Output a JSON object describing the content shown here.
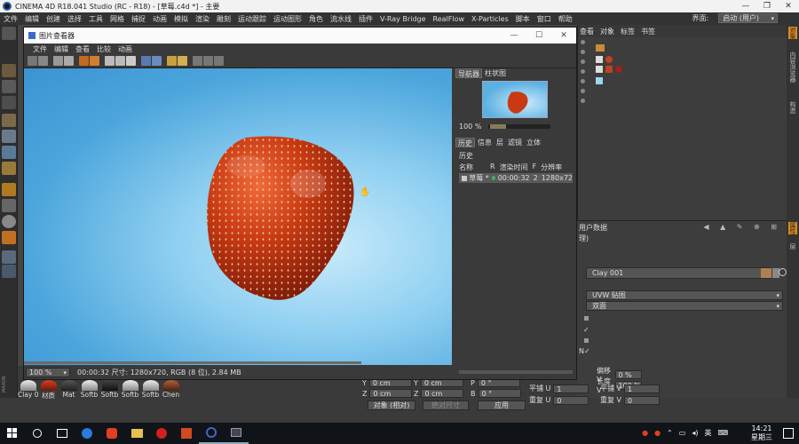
{
  "app": {
    "title": "CINEMA 4D R18.041 Studio (RC - R18) - [草莓.c4d *] - 主要",
    "window_buttons": [
      "—",
      "❐",
      "✕"
    ]
  },
  "menubar": {
    "items": [
      "文件",
      "编辑",
      "创建",
      "选择",
      "工具",
      "网格",
      "捕捉",
      "动画",
      "模拟",
      "渲染",
      "雕刻",
      "运动跟踪",
      "运动图形",
      "角色",
      "流水线",
      "插件",
      "V-Ray Bridge",
      "RealFlow",
      "X-Particles",
      "脚本",
      "窗口",
      "帮助"
    ],
    "layout_label": "界面:",
    "layout_value": "启动 (用户)"
  },
  "object_panel": {
    "tabs": [
      "查看",
      "对象",
      "标签",
      "书签"
    ]
  },
  "side_tabs": [
    "对象",
    "内容浏览器",
    "构造",
    "属性",
    "层"
  ],
  "attributes": {
    "header": "用户数据",
    "sub": "理)",
    "material_field": "Clay 001",
    "projection": "UVW 贴图",
    "side": "双面",
    "offset_u_label": "偏移 V",
    "offset_u_value": "0 %",
    "length_label": "长度 V",
    "length_value": "100 %",
    "tile_u_label": "平铺 U",
    "tile_u_value": "1",
    "tile_v_label": "平铺 V",
    "tile_v_value": "1",
    "repeat_u_label": "重复 U",
    "repeat_u_value": "0",
    "repeat_v_label": "重复 V",
    "repeat_v_value": "0",
    "check_prefix": "N"
  },
  "materials": [
    "Clay 0",
    "材质",
    "Mat",
    "Softb",
    "Softb",
    "Softb",
    "Softb",
    "Chen"
  ],
  "coords": {
    "y_pos": "0 cm",
    "y_size": "0 cm",
    "p_rot": "0 °",
    "z_pos": "0 cm",
    "z_size": "0 cm",
    "b_rot": "0 °",
    "object_mode": "对象 (相对)",
    "size_mode": "绝对尺寸",
    "apply": "应用",
    "labels": {
      "y": "Y",
      "z": "Z",
      "p": "P",
      "b": "B"
    }
  },
  "picture_viewer": {
    "title": "图片查看器",
    "menu": [
      "文件",
      "编辑",
      "查看",
      "比较",
      "动画"
    ],
    "status_zoom": "100 %",
    "status_info": "00:00:32  尺寸: 1280x720, RGB (8 位), 2.84 MB",
    "side_tabs_top": [
      "导航器",
      "柱状图"
    ],
    "nav_zoom": "100 %",
    "side_tabs_bottom": [
      "历史",
      "信息",
      "层",
      "滤镜",
      "立体"
    ],
    "history_title": "历史",
    "history_cols": [
      "名称",
      "R",
      "渲染时间",
      "F",
      "分辨率"
    ],
    "history_row": {
      "name": "草莓 *",
      "time": "00:00:32",
      "frame": "2",
      "res": "1280x72"
    }
  },
  "taskbar": {
    "time": "14:21",
    "day": "星期三",
    "ime": "英"
  },
  "colors": {
    "accent_orange": "#d88a1e",
    "render_blue": "#4ca6dc",
    "strawberry_red": "#c93a14"
  }
}
